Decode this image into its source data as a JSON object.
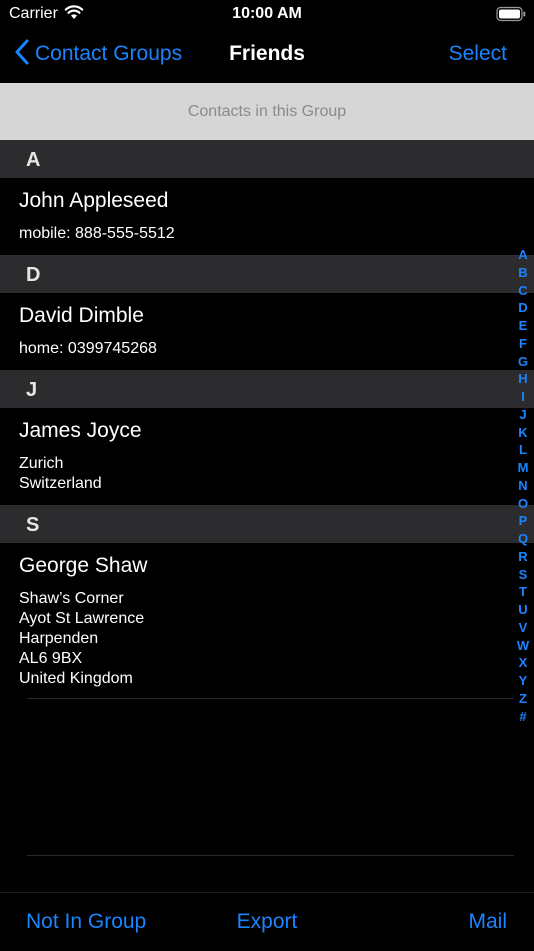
{
  "status_bar": {
    "carrier": "Carrier",
    "time": "10:00 AM"
  },
  "nav": {
    "back_label": "Contact Groups",
    "title": "Friends",
    "select_label": "Select"
  },
  "group_header": "Contacts in this Group",
  "sections": [
    {
      "letter": "A",
      "name": "John Appleseed",
      "details": [
        "mobile: 888-555-5512"
      ]
    },
    {
      "letter": "D",
      "name": "David Dimble",
      "details": [
        "home: 0399745268"
      ]
    },
    {
      "letter": "J",
      "name": "James Joyce",
      "details": [
        "Zurich",
        "Switzerland"
      ]
    },
    {
      "letter": "S",
      "name": "George Shaw",
      "details": [
        "Shaw’s Corner",
        "Ayot St Lawrence",
        "Harpenden",
        "AL6 9BX",
        "United Kingdom"
      ]
    }
  ],
  "index_letters": [
    "A",
    "B",
    "C",
    "D",
    "E",
    "F",
    "G",
    "H",
    "I",
    "J",
    "K",
    "L",
    "M",
    "N",
    "O",
    "P",
    "Q",
    "R",
    "S",
    "T",
    "U",
    "V",
    "W",
    "X",
    "Y",
    "Z",
    "#"
  ],
  "toolbar": {
    "left_label": "Not In Group",
    "center_label": "Export",
    "right_label": "Mail"
  },
  "colors": {
    "accent": "#1a84ff",
    "section_header": "#2c2c2e",
    "group_header": "#d6d6d6"
  }
}
